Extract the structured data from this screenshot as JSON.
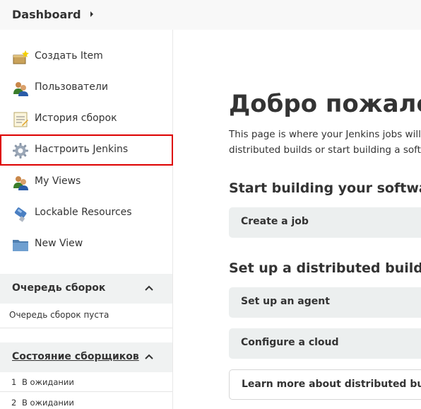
{
  "breadcrumb": {
    "label": "Dashboard"
  },
  "sidebar": {
    "tasks": [
      {
        "label": "Создать Item",
        "icon": "new-item-icon"
      },
      {
        "label": "Пользователи",
        "icon": "users-icon"
      },
      {
        "label": "История сборок",
        "icon": "build-history-icon"
      },
      {
        "label": "Настроить Jenkins",
        "icon": "gear-icon"
      },
      {
        "label": "My Views",
        "icon": "users-icon"
      },
      {
        "label": "Lockable Resources",
        "icon": "usb-lock-icon"
      },
      {
        "label": "New View",
        "icon": "folder-icon"
      }
    ],
    "queue": {
      "title": "Очередь сборок",
      "empty_text": "Очередь сборок пуста"
    },
    "executors": {
      "title": "Состояние сборщиков",
      "rows": [
        {
          "num": "1",
          "state": "В ожидании"
        },
        {
          "num": "2",
          "state": "В ожидании"
        }
      ]
    }
  },
  "main": {
    "title": "Добро пожаловать в Jenkins!",
    "intro_line1": "This page is where your Jenkins jobs will be displayed. To get started, you can set up",
    "intro_line2": "distributed builds or start building a software project.",
    "start_heading": "Start building your software project",
    "create_job": "Create a job",
    "distributed_heading": "Set up a distributed build",
    "setup_agent": "Set up an agent",
    "configure_cloud": "Configure a cloud",
    "learn_more": "Learn more about distributed builds"
  },
  "colors": {
    "highlight": "#dd0000",
    "pane_header": "#f0f2f2",
    "action_bg": "#ecefef"
  }
}
